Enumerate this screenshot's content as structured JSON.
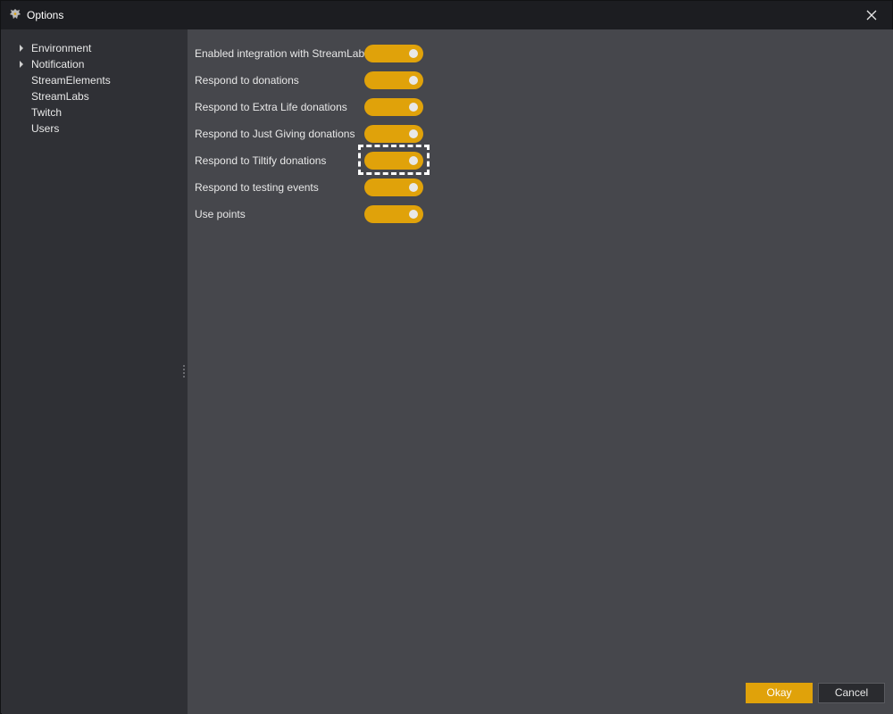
{
  "window": {
    "title": "Options",
    "app_icon": "dragon-emblem-icon",
    "close_icon": "close-icon"
  },
  "sidebar": {
    "items": [
      {
        "label": "Environment",
        "expandable": true
      },
      {
        "label": "Notification",
        "expandable": true
      },
      {
        "label": "StreamElements",
        "expandable": false
      },
      {
        "label": "StreamLabs",
        "expandable": false
      },
      {
        "label": "Twitch",
        "expandable": false
      },
      {
        "label": "Users",
        "expandable": false
      }
    ]
  },
  "settings": {
    "rows": [
      {
        "label": "Enabled integration with StreamLabs",
        "on": true
      },
      {
        "label": "Respond to donations",
        "on": true
      },
      {
        "label": "Respond to Extra Life donations",
        "on": true
      },
      {
        "label": "Respond to Just Giving donations",
        "on": true
      },
      {
        "label": "Respond to Tiltify donations",
        "on": true,
        "focused": true
      },
      {
        "label": "Respond to testing events",
        "on": true
      },
      {
        "label": "Use points",
        "on": true
      }
    ]
  },
  "footer": {
    "okay_label": "Okay",
    "cancel_label": "Cancel"
  },
  "colors": {
    "accent": "#e0a20a",
    "titlebar": "#1c1d21",
    "sidebar": "#2f3035",
    "content": "#46474c"
  }
}
